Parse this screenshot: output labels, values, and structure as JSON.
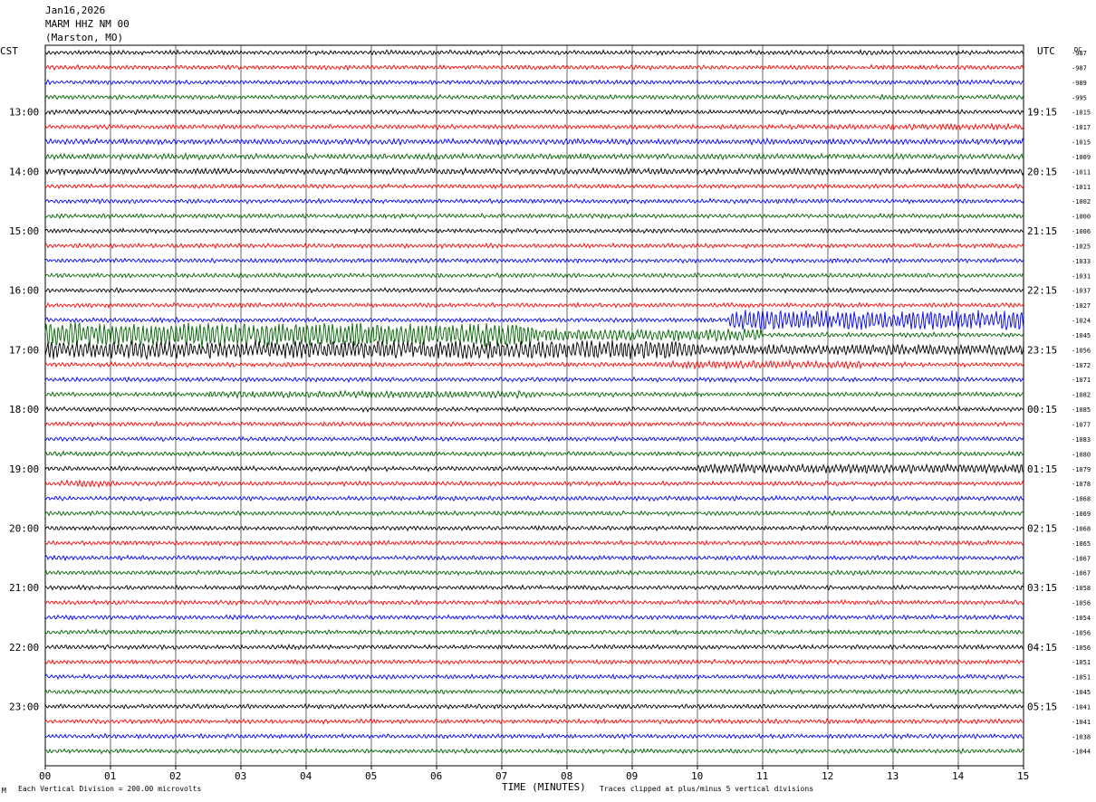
{
  "header": {
    "date": "Jan16,2026",
    "station": "MARM HHZ NM 00",
    "location": "(Marston, MO)"
  },
  "left_tz": "CST",
  "right_tz": "UTC",
  "dc_label": "DC",
  "footer": {
    "scale": "Each Vertical Division =  200.00 microvolts",
    "xaxis_title": "TIME (MINUTES)",
    "clip_note": "Traces clipped at plus/minus 5 vertical divisions",
    "mark": "M"
  },
  "colors": {
    "trace_cycle": [
      "#000000",
      "#ff0000",
      "#0000ff",
      "#006400"
    ],
    "grid": "#000000",
    "background": "#ffffff"
  },
  "chart_data": {
    "type": "helicorder",
    "x_unit": "minutes",
    "xlim": [
      0,
      15
    ],
    "x_ticks": [
      "00",
      "01",
      "02",
      "03",
      "04",
      "05",
      "06",
      "07",
      "08",
      "09",
      "10",
      "11",
      "12",
      "13",
      "14",
      "15"
    ],
    "rows_per_hour": 4,
    "row_count": 48,
    "left_hour_labels": [
      "13:00",
      "14:00",
      "15:00",
      "16:00",
      "17:00",
      "18:00",
      "19:00",
      "20:00",
      "21:00",
      "22:00",
      "23:00"
    ],
    "right_hour_labels": [
      "19:15",
      "20:15",
      "21:15",
      "22:15",
      "23:15",
      "00:15",
      "01:15",
      "02:15",
      "03:15",
      "04:15",
      "05:15"
    ],
    "hour_label_rows": [
      4,
      8,
      12,
      16,
      20,
      24,
      28,
      32,
      36,
      40,
      44
    ],
    "dc_offsets": [
      -987,
      -987,
      -989,
      -995,
      -1015,
      -1017,
      -1015,
      -1009,
      -1011,
      -1011,
      -1002,
      -1000,
      -1006,
      -1025,
      -1033,
      -1031,
      -1037,
      -1027,
      -1024,
      -1045,
      -1056,
      -1072,
      -1071,
      -1082,
      -1085,
      -1077,
      -1083,
      -1080,
      -1079,
      -1078,
      -1068,
      -1069,
      -1068,
      -1065,
      -1067,
      -1067,
      -1058,
      -1056,
      -1054,
      -1056,
      -1056,
      -1051,
      -1051,
      -1045,
      -1041,
      -1041,
      -1038,
      -1044
    ],
    "activity": [
      {
        "row": 18,
        "start_min": 10.5,
        "end_min": 15,
        "level": 5
      },
      {
        "row": 19,
        "start_min": 0,
        "end_min": 7.5,
        "level": 6
      },
      {
        "row": 19,
        "start_min": 7.5,
        "end_min": 11,
        "level": 3
      },
      {
        "row": 20,
        "start_min": 0,
        "end_min": 10,
        "level": 4.5
      },
      {
        "row": 20,
        "start_min": 10,
        "end_min": 15,
        "level": 2.5
      },
      {
        "row": 21,
        "start_min": 9.5,
        "end_min": 12.5,
        "level": 1.8
      },
      {
        "row": 23,
        "start_min": 2.5,
        "end_min": 7.5,
        "level": 1.6
      },
      {
        "row": 28,
        "start_min": 10,
        "end_min": 15,
        "level": 2.2
      },
      {
        "row": 29,
        "start_min": 0.2,
        "end_min": 1.1,
        "level": 1.6
      },
      {
        "row": 5,
        "start_min": 12,
        "end_min": 15,
        "level": 1.4
      },
      {
        "row": 6,
        "start_min": 0,
        "end_min": 15,
        "level": 1.3
      },
      {
        "row": 7,
        "start_min": 0,
        "end_min": 15,
        "level": 1.3
      },
      {
        "row": 8,
        "start_min": 0,
        "end_min": 15,
        "level": 1.4
      }
    ]
  }
}
